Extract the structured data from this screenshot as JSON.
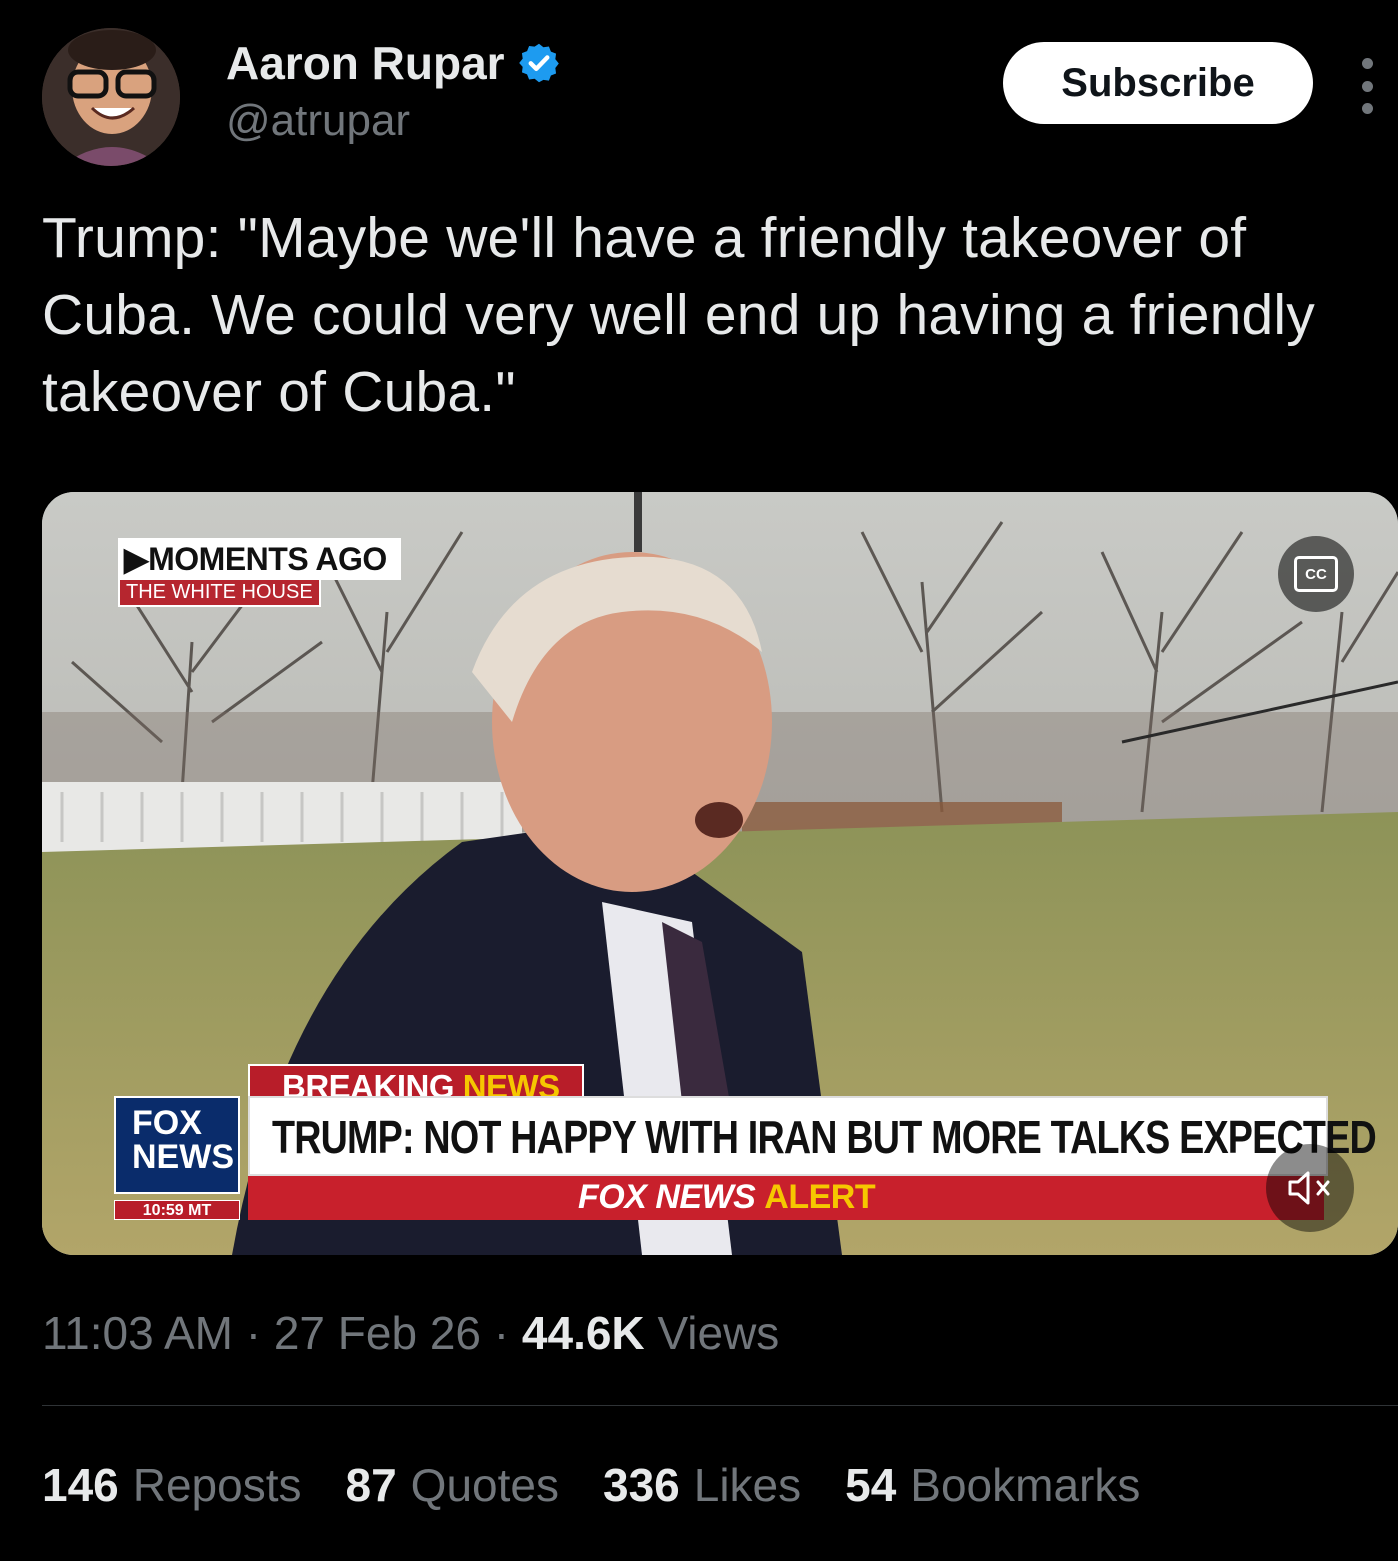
{
  "author": {
    "name": "Aaron Rupar",
    "handle": "@atrupar"
  },
  "header": {
    "subscribe_label": "Subscribe"
  },
  "tweet": {
    "text": "Trump: \"Maybe we'll have a friendly takeover of Cuba. We could very well end up having a friendly takeover of Cuba.\""
  },
  "video": {
    "moments_label": "▶MOMENTS AGO",
    "location_label": "THE WHITE HOUSE",
    "breaking_label_1": "BREAKING ",
    "breaking_label_2": "NEWS",
    "headline": "TRUMP: NOT HAPPY WITH IRAN BUT MORE TALKS EXPECTED",
    "alert_label_1": "FOX NEWS ",
    "alert_label_2": "ALERT",
    "network_logo_line1": "FOX",
    "network_logo_line2": "NEWS",
    "network_time": "10:59 MT",
    "cc_label": "CC"
  },
  "meta": {
    "time": "11:03 AM",
    "date": "27 Feb 26",
    "views_count": "44.6K",
    "views_label": "Views"
  },
  "stats": [
    {
      "count": "146",
      "label": "Reposts"
    },
    {
      "count": "87",
      "label": "Quotes"
    },
    {
      "count": "336",
      "label": "Likes"
    },
    {
      "count": "54",
      "label": "Bookmarks"
    }
  ]
}
